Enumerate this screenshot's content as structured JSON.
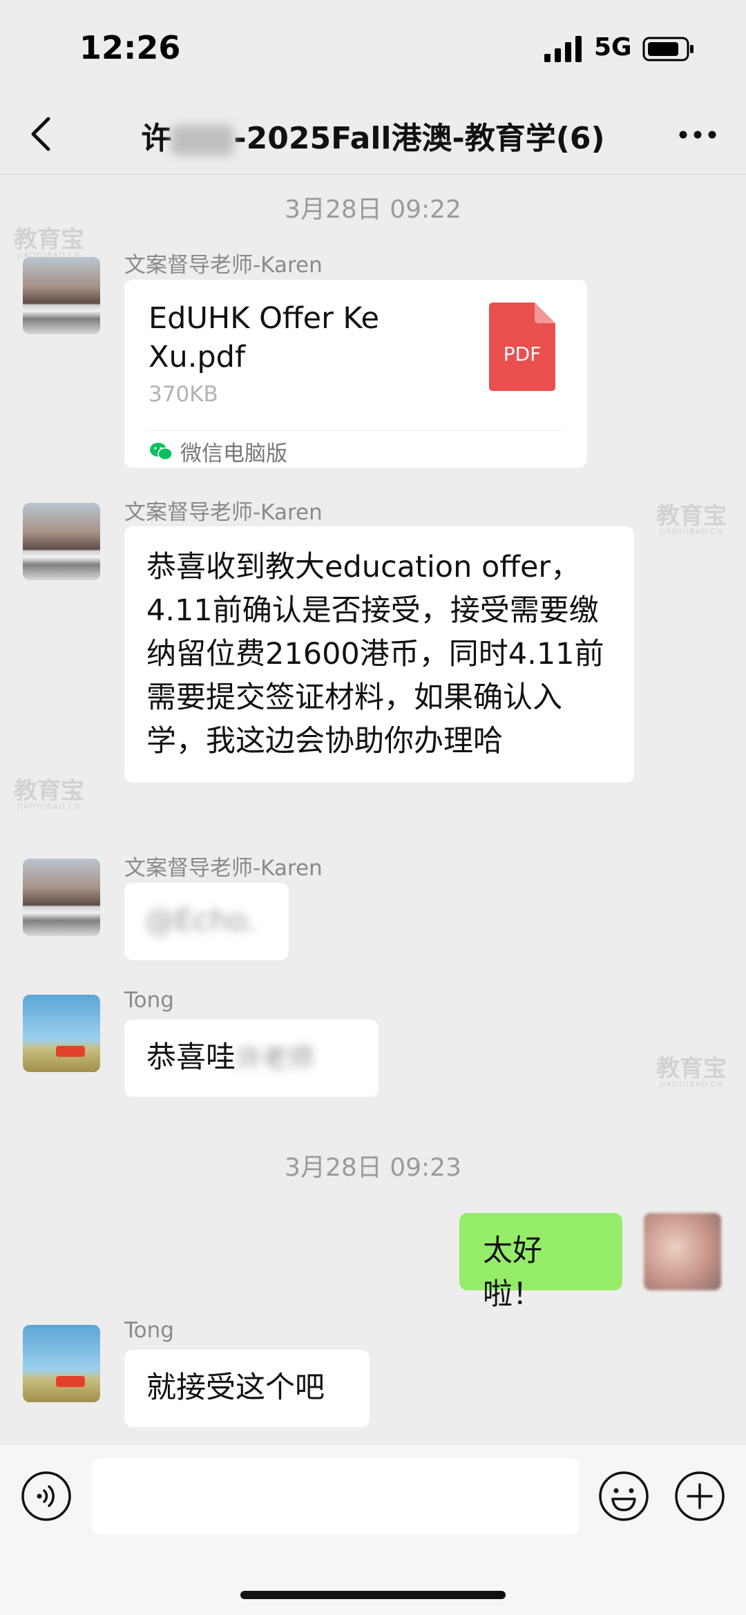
{
  "status_bar": {
    "time": "12:26",
    "network": "5G",
    "icons": [
      "signal-icon",
      "battery-icon"
    ]
  },
  "nav": {
    "title_prefix": "许",
    "title_suffix": "-2025Fall港澳-教育学(6)",
    "icons": [
      "back-chevron-icon",
      "more-icon"
    ]
  },
  "messages": {
    "ts1": "3月28日 09:22",
    "m1": {
      "sender": "文案督导老师-Karen",
      "file_name": "EdUHK Offer Ke Xu.pdf",
      "file_size": "370KB",
      "file_type": "PDF",
      "source": "微信电脑版"
    },
    "m2": {
      "sender": "文案督导老师-Karen",
      "text": "恭喜收到教大education offer，4.11前确认是否接受，接受需要缴纳留位费21600港币，同时4.11前需要提交签证材料，如果确认入学，我这边会协助你办理哈"
    },
    "m3": {
      "sender": "文案督导老师-Karen",
      "text_blurred": "@Echo."
    },
    "m4": {
      "sender": "Tong",
      "text": "恭喜哇",
      "text_blurred": "许老师"
    },
    "ts2": "3月28日 09:23",
    "m5": {
      "text": "太好啦！"
    },
    "m6": {
      "sender": "Tong",
      "text": "就接受这个吧"
    }
  },
  "input_bar": {
    "icons": [
      "voice-icon",
      "emoji-icon",
      "plus-icon"
    ],
    "value": "",
    "placeholder": ""
  },
  "watermark": {
    "cn": "教育宝",
    "en": "JIAOYUBAO.CN"
  },
  "colors": {
    "background": "#ededed",
    "bubble_self": "#95ec69",
    "bubble_other": "#ffffff",
    "pdf_red": "#e94f4f",
    "wechat_green": "#07c160"
  }
}
